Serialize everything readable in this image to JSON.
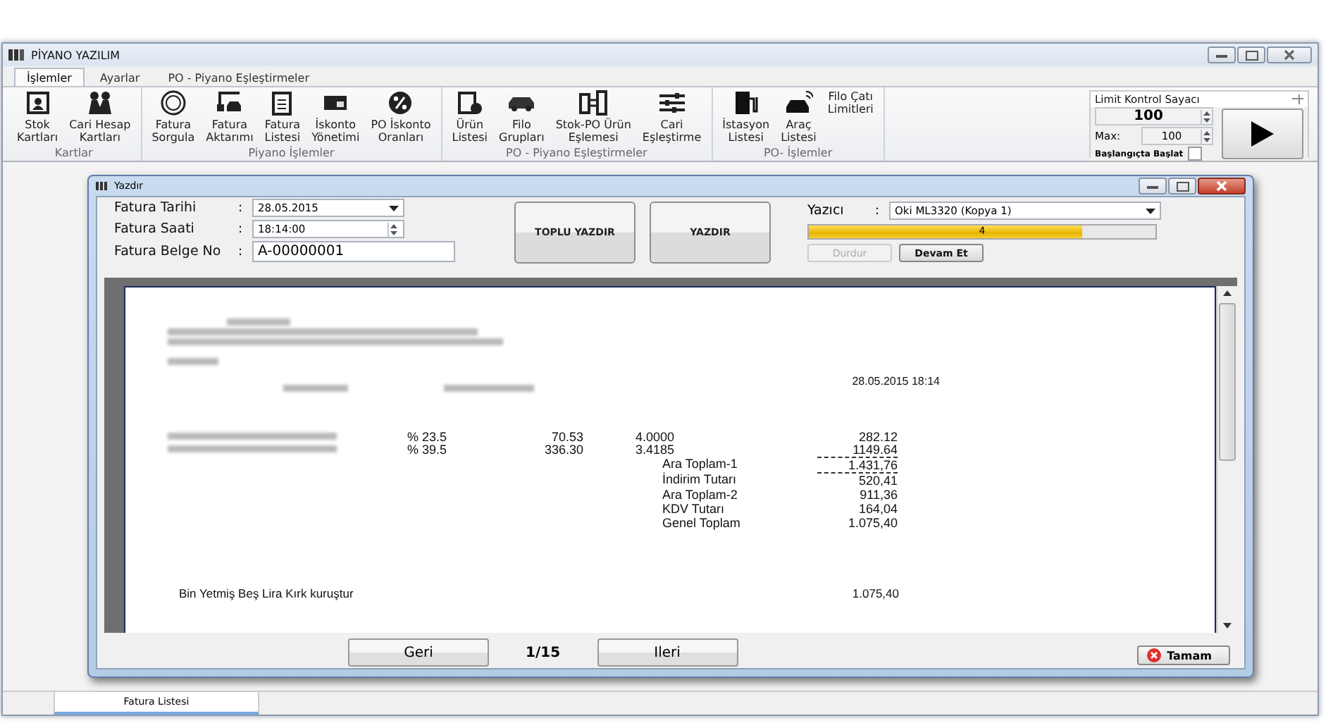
{
  "window": {
    "title": "PİYANO YAZILIM"
  },
  "ribbon": {
    "tabs": [
      {
        "label": "İşlemler",
        "selected": true
      },
      {
        "label": "Ayarlar",
        "selected": false
      },
      {
        "label": "PO - Piyano Eşleştirmeler",
        "selected": false
      }
    ],
    "groups": [
      {
        "label": "Kartlar",
        "buttons": [
          "Stok\nKartları",
          "Cari Hesap\nKartları"
        ]
      },
      {
        "label": "Piyano İşlemler",
        "buttons": [
          "Fatura\nSorgula",
          "Fatura\nAktarımı",
          "Fatura\nListesi",
          "İskonto\nYönetimi",
          "PO İskonto\nOranları"
        ]
      },
      {
        "label": "PO - Piyano Eşleştirmeler",
        "buttons": [
          "Ürün\nListesi",
          "Filo\nGrupları",
          "Stok-PO Ürün\nEşlemesi",
          "Cari\nEşleştirme"
        ]
      },
      {
        "label": "PO- İşlemler",
        "buttons": [
          "İstasyon\nListesi",
          "Araç\nListesi",
          "Filo Çatı\nLimitleri"
        ]
      }
    ]
  },
  "limit_panel": {
    "title": "Limit Kontrol Sayacı",
    "counter": "100",
    "max_label": "Max:",
    "max_value": "100",
    "autostart_label": "Başlangıçta Başlat",
    "autostart_checked": false
  },
  "dialog": {
    "title": "Yazdır",
    "fields": [
      {
        "kind": "dropdown",
        "label": "Fatura Tarihi",
        "colon": ":",
        "value": "28.05.2015"
      },
      {
        "kind": "spinner",
        "label": "Fatura Saati",
        "colon": ":",
        "value": "18:14:00"
      },
      {
        "kind": "text",
        "label": "Fatura Belge No",
        "colon": ":",
        "value": "A-00000001"
      }
    ],
    "print_buttons": [
      "TOPLU YAZDIR",
      "YAZDIR"
    ],
    "printer": {
      "label": "Yazıcı",
      "colon": ":",
      "value": "Oki ML3320 (Kopya 1)"
    },
    "progress": {
      "level": 0.79,
      "text": "4"
    },
    "actions": [
      {
        "label": "Durdur",
        "disabled": true
      },
      {
        "label": "Devam Et",
        "disabled": false
      }
    ],
    "document": {
      "datetime": "28.05.2015  18:14",
      "items": [
        {
          "percent": "% 23.5",
          "price": "70.53",
          "quantity": "4.0000",
          "total": "282.12"
        },
        {
          "percent": "% 39.5",
          "price": "336.30",
          "quantity": "3.4185",
          "total": "1149.64"
        }
      ],
      "summary": [
        {
          "label": "Ara Toplam-1",
          "value": "1.431,76",
          "ruled_above": true
        },
        {
          "label": "İndirim Tutarı",
          "value": "520,41",
          "ruled_above": true
        },
        {
          "label": "Ara Toplam-2",
          "value": "911,36",
          "ruled_above": false
        },
        {
          "label": "KDV Tutarı",
          "value": "164,04",
          "ruled_above": false
        },
        {
          "label": "Genel Toplam",
          "value": "1.075,40",
          "ruled_above": false
        }
      ],
      "amount_in_words": "Bin Yetmiş Beş Lira Kırk kuruştur",
      "amount": "1.075,40"
    },
    "nav": {
      "previous": "Geri",
      "page": "1/15",
      "next": "Ileri"
    },
    "ok_button": "Tamam"
  },
  "bottom_tabs": [
    {
      "label": "Fatura Listesi",
      "selected": true
    }
  ]
}
